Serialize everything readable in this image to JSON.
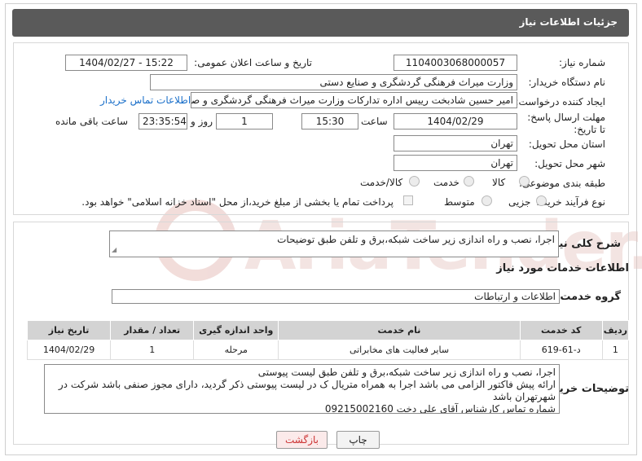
{
  "header": {
    "title": "جزئیات اطلاعات نیاز"
  },
  "form": {
    "need_number_label": "شماره نیاز:",
    "need_number": "1104003068000057",
    "announce_label": "تاریخ و ساعت اعلان عمومی:",
    "announce_value": "1404/02/27 - 15:22",
    "buyer_org_label": "نام دستگاه خریدار:",
    "buyer_org": "وزارت میراث فرهنگی  گردشگری و صنایع دستی",
    "creator_label": "ایجاد کننده درخواست:",
    "creator": "امیر حسین شادبخت رییس اداره تدارکات وزارت میراث فرهنگی  گردشگری و صنایع دستی",
    "contact_link": "اطلاعات تماس خریدار",
    "deadline_label": "مهلت ارسال پاسخ: تا تاریخ:",
    "deadline_date": "1404/02/29",
    "time_label": "ساعت",
    "deadline_time": "15:30",
    "days_value": "1",
    "days_label": "روز و",
    "remaining_time": "23:35:54",
    "remaining_label": "ساعت باقی مانده",
    "province_label": "استان محل تحویل:",
    "province": "تهران",
    "city_label": "شهر محل تحویل:",
    "city": "تهران",
    "category_label": "طبقه بندی موضوعی:",
    "category_options": [
      "کالا",
      "خدمت",
      "کالا/خدمت"
    ],
    "process_label": "نوع فرآیند خرید :",
    "process_options": [
      "جزیی",
      "متوسط"
    ],
    "payment_note": "پرداخت تمام یا بخشی از مبلغ خرید،از محل \"اسناد خزانه اسلامی\" خواهد بود."
  },
  "summary": {
    "label": "شرح کلی نیاز:",
    "text": "اجرا، نصب و راه اندازی زیر ساخت شبکه،برق و تلفن طبق توضیحات"
  },
  "services": {
    "section_title": "اطلاعات خدمات مورد نیاز",
    "group_label": "گروه خدمت:",
    "group_value": "اطلاعات و ارتباطات",
    "columns": [
      "ردیف",
      "کد خدمت",
      "نام خدمت",
      "واحد اندازه گیری",
      "تعداد / مقدار",
      "تاریخ نیاز"
    ],
    "rows": [
      {
        "row": "1",
        "code": "د-61-619",
        "name": "سایر فعالیت های مخابراتی",
        "unit": "مرحله",
        "qty": "1",
        "date": "1404/02/29"
      }
    ]
  },
  "buyer_notes": {
    "label": "توضیحات خریدار:",
    "lines": [
      "اجرا، نصب و راه اندازی زیر ساخت شبکه،برق و تلفن طبق لیست پیوستی",
      "ارائه پیش فاکتور الزامی می باشد اجرا به همراه متریال ک در لیست پیوستی ذکر گردید، دارای مجوز صنفی باشد شرکت در شهرتهران باشد",
      "شماره تماس کارشناس آقای علی دخت 09215002160"
    ]
  },
  "buttons": {
    "print": "چاپ",
    "back": "بازگشت"
  },
  "watermark": {
    "text": "AriaTender.neT"
  },
  "colors": {
    "header_bg": "#5a5a5a",
    "link": "#1a6fc9",
    "watermark": "#e7c9c6",
    "back_btn_text": "#cc3333"
  }
}
